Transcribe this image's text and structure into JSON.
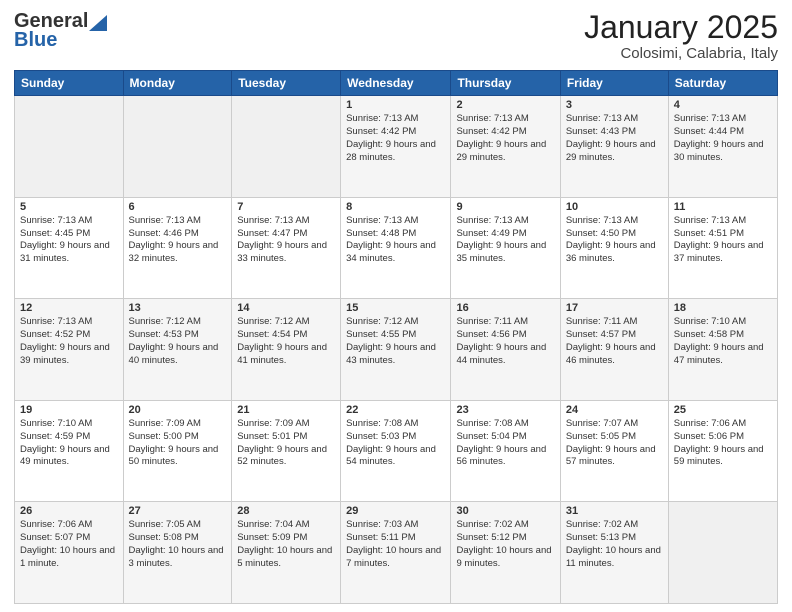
{
  "logo": {
    "line1": "General",
    "line2": "Blue"
  },
  "title": "January 2025",
  "location": "Colosimi, Calabria, Italy",
  "weekdays": [
    "Sunday",
    "Monday",
    "Tuesday",
    "Wednesday",
    "Thursday",
    "Friday",
    "Saturday"
  ],
  "weeks": [
    [
      {
        "day": "",
        "info": ""
      },
      {
        "day": "",
        "info": ""
      },
      {
        "day": "",
        "info": ""
      },
      {
        "day": "1",
        "info": "Sunrise: 7:13 AM\nSunset: 4:42 PM\nDaylight: 9 hours and 28 minutes."
      },
      {
        "day": "2",
        "info": "Sunrise: 7:13 AM\nSunset: 4:42 PM\nDaylight: 9 hours and 29 minutes."
      },
      {
        "day": "3",
        "info": "Sunrise: 7:13 AM\nSunset: 4:43 PM\nDaylight: 9 hours and 29 minutes."
      },
      {
        "day": "4",
        "info": "Sunrise: 7:13 AM\nSunset: 4:44 PM\nDaylight: 9 hours and 30 minutes."
      }
    ],
    [
      {
        "day": "5",
        "info": "Sunrise: 7:13 AM\nSunset: 4:45 PM\nDaylight: 9 hours and 31 minutes."
      },
      {
        "day": "6",
        "info": "Sunrise: 7:13 AM\nSunset: 4:46 PM\nDaylight: 9 hours and 32 minutes."
      },
      {
        "day": "7",
        "info": "Sunrise: 7:13 AM\nSunset: 4:47 PM\nDaylight: 9 hours and 33 minutes."
      },
      {
        "day": "8",
        "info": "Sunrise: 7:13 AM\nSunset: 4:48 PM\nDaylight: 9 hours and 34 minutes."
      },
      {
        "day": "9",
        "info": "Sunrise: 7:13 AM\nSunset: 4:49 PM\nDaylight: 9 hours and 35 minutes."
      },
      {
        "day": "10",
        "info": "Sunrise: 7:13 AM\nSunset: 4:50 PM\nDaylight: 9 hours and 36 minutes."
      },
      {
        "day": "11",
        "info": "Sunrise: 7:13 AM\nSunset: 4:51 PM\nDaylight: 9 hours and 37 minutes."
      }
    ],
    [
      {
        "day": "12",
        "info": "Sunrise: 7:13 AM\nSunset: 4:52 PM\nDaylight: 9 hours and 39 minutes."
      },
      {
        "day": "13",
        "info": "Sunrise: 7:12 AM\nSunset: 4:53 PM\nDaylight: 9 hours and 40 minutes."
      },
      {
        "day": "14",
        "info": "Sunrise: 7:12 AM\nSunset: 4:54 PM\nDaylight: 9 hours and 41 minutes."
      },
      {
        "day": "15",
        "info": "Sunrise: 7:12 AM\nSunset: 4:55 PM\nDaylight: 9 hours and 43 minutes."
      },
      {
        "day": "16",
        "info": "Sunrise: 7:11 AM\nSunset: 4:56 PM\nDaylight: 9 hours and 44 minutes."
      },
      {
        "day": "17",
        "info": "Sunrise: 7:11 AM\nSunset: 4:57 PM\nDaylight: 9 hours and 46 minutes."
      },
      {
        "day": "18",
        "info": "Sunrise: 7:10 AM\nSunset: 4:58 PM\nDaylight: 9 hours and 47 minutes."
      }
    ],
    [
      {
        "day": "19",
        "info": "Sunrise: 7:10 AM\nSunset: 4:59 PM\nDaylight: 9 hours and 49 minutes."
      },
      {
        "day": "20",
        "info": "Sunrise: 7:09 AM\nSunset: 5:00 PM\nDaylight: 9 hours and 50 minutes."
      },
      {
        "day": "21",
        "info": "Sunrise: 7:09 AM\nSunset: 5:01 PM\nDaylight: 9 hours and 52 minutes."
      },
      {
        "day": "22",
        "info": "Sunrise: 7:08 AM\nSunset: 5:03 PM\nDaylight: 9 hours and 54 minutes."
      },
      {
        "day": "23",
        "info": "Sunrise: 7:08 AM\nSunset: 5:04 PM\nDaylight: 9 hours and 56 minutes."
      },
      {
        "day": "24",
        "info": "Sunrise: 7:07 AM\nSunset: 5:05 PM\nDaylight: 9 hours and 57 minutes."
      },
      {
        "day": "25",
        "info": "Sunrise: 7:06 AM\nSunset: 5:06 PM\nDaylight: 9 hours and 59 minutes."
      }
    ],
    [
      {
        "day": "26",
        "info": "Sunrise: 7:06 AM\nSunset: 5:07 PM\nDaylight: 10 hours and 1 minute."
      },
      {
        "day": "27",
        "info": "Sunrise: 7:05 AM\nSunset: 5:08 PM\nDaylight: 10 hours and 3 minutes."
      },
      {
        "day": "28",
        "info": "Sunrise: 7:04 AM\nSunset: 5:09 PM\nDaylight: 10 hours and 5 minutes."
      },
      {
        "day": "29",
        "info": "Sunrise: 7:03 AM\nSunset: 5:11 PM\nDaylight: 10 hours and 7 minutes."
      },
      {
        "day": "30",
        "info": "Sunrise: 7:02 AM\nSunset: 5:12 PM\nDaylight: 10 hours and 9 minutes."
      },
      {
        "day": "31",
        "info": "Sunrise: 7:02 AM\nSunset: 5:13 PM\nDaylight: 10 hours and 11 minutes."
      },
      {
        "day": "",
        "info": ""
      }
    ]
  ]
}
